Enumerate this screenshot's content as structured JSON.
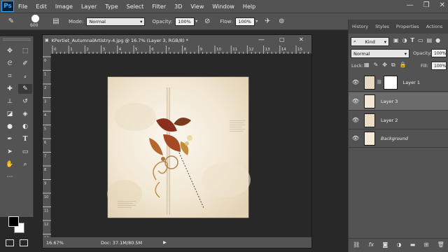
{
  "menubar": {
    "logo": "Ps",
    "items": [
      "File",
      "Edit",
      "Image",
      "Layer",
      "Type",
      "Select",
      "Filter",
      "3D",
      "View",
      "Window",
      "Help"
    ]
  },
  "options": {
    "brush_size": "600",
    "mode_label": "Mode:",
    "mode_value": "Normal",
    "opacity_label": "Opacity:",
    "opacity_value": "100%",
    "flow_label": "Flow:",
    "flow_value": "100%"
  },
  "document": {
    "title": "KPertiet_AutumnalArtistry-4.jpg @ 16.7% (Layer 3, RGB/8) *",
    "zoom": "16.67%",
    "doc_info": "Doc: 37.1M/80.5M",
    "ruler_labels": [
      "0",
      "1",
      "2",
      "3",
      "4",
      "5",
      "6",
      "7",
      "8",
      "9",
      "10",
      "11",
      "12",
      "13",
      "14",
      "15",
      "16"
    ],
    "ruler_v_labels": [
      "0",
      "1",
      "2",
      "3",
      "4",
      "5",
      "6",
      "7",
      "8",
      "9",
      "10",
      "11",
      "12",
      "13"
    ]
  },
  "panels": {
    "tabs": [
      "History",
      "Styles",
      "Properties",
      "Actions"
    ],
    "kind_label": "Kind",
    "blend_mode": "Normal",
    "opacity_label": "Opacity:",
    "opacity_value": "100%",
    "lock_label": "Lock:",
    "fill_label": "Fill:",
    "fill_value": "100%",
    "layers": [
      {
        "name": "Layer 1"
      },
      {
        "name": "Layer 3"
      },
      {
        "name": "Layer 2"
      },
      {
        "name": "Background"
      }
    ]
  },
  "colors": {
    "ui_dark": "#535353",
    "workspace": "#282828",
    "accent": "#31a8ff"
  }
}
